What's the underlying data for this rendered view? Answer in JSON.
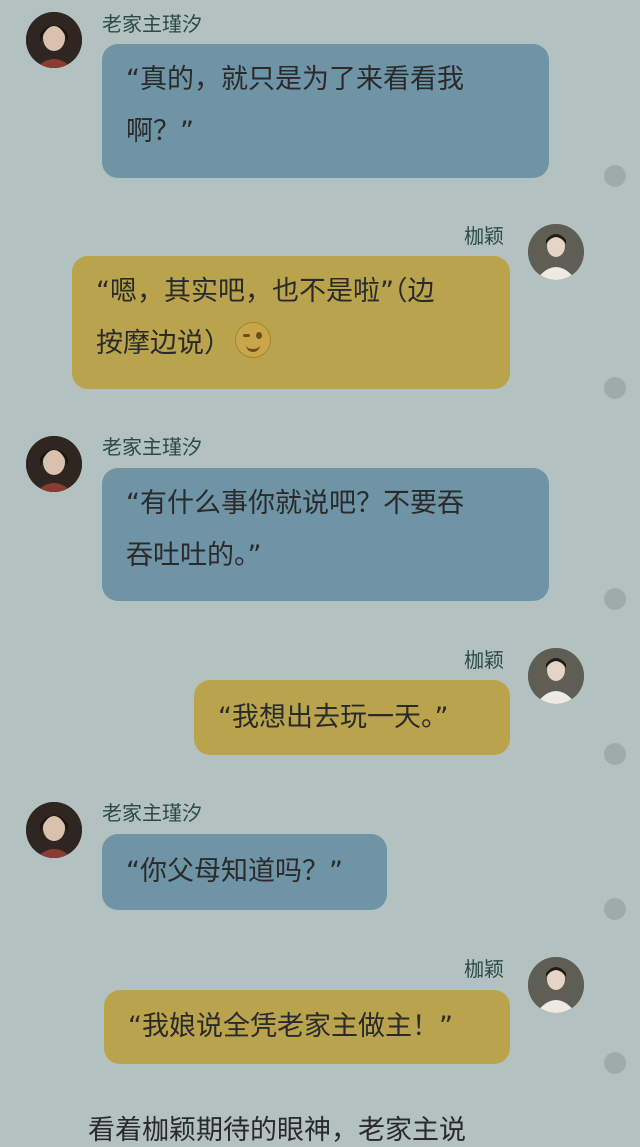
{
  "messages": [
    {
      "sender": "老家主瑾汐",
      "lines": [
        "“真的，就只是为了来看看我",
        "啊？”"
      ]
    },
    {
      "sender": "枷颖",
      "lines": [
        "“嗯，其实吧，也不是啦”（边",
        "按摩边说）"
      ],
      "emoji": "winking-face-icon"
    },
    {
      "sender": "老家主瑾汐",
      "lines": [
        "“有什么事你就说吧？不要吞",
        "吞吐吐的。”"
      ]
    },
    {
      "sender": "枷颖",
      "lines": [
        "“我想出去玩一天。”"
      ]
    },
    {
      "sender": "老家主瑾汐",
      "lines": [
        "“你父母知道吗？”"
      ]
    },
    {
      "sender": "枷颖",
      "lines": [
        "“我娘说全凭老家主做主！”"
      ]
    }
  ],
  "footer_text": "看着枷颖期待的眼神，老家主说",
  "colors": {
    "background": "#b3c1c0",
    "left_bubble": "#6f94a6",
    "right_bubble": "#b9a44d",
    "name_text": "#2c4a4a"
  }
}
